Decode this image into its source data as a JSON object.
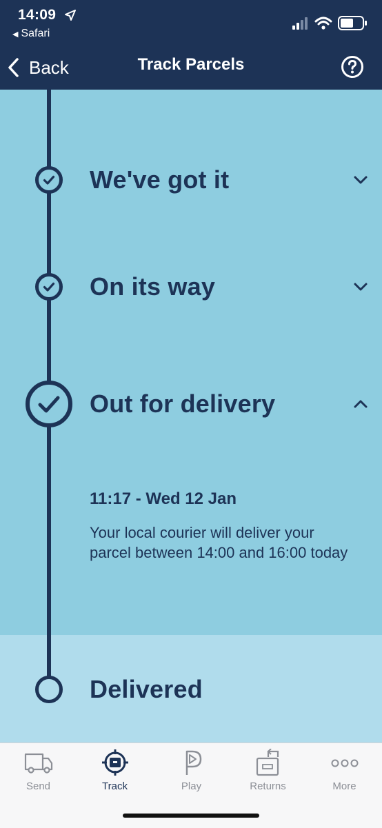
{
  "status_bar": {
    "time": "14:09",
    "back_app": "Safari"
  },
  "nav": {
    "back_label": "Back",
    "title": "Track Parcels"
  },
  "stages": [
    {
      "title": "We've got it",
      "state": "complete",
      "expanded": false
    },
    {
      "title": "On its way",
      "state": "complete",
      "expanded": false
    },
    {
      "title": "Out for delivery",
      "state": "current",
      "expanded": true
    },
    {
      "title": "Delivered",
      "state": "pending",
      "expanded": false
    }
  ],
  "event": {
    "time": "11:17 - Wed 12 Jan",
    "text": "Your local courier will deliver your parcel between 14:00 and 16:00 today"
  },
  "tabs": [
    {
      "label": "Send",
      "icon": "van-icon",
      "active": false
    },
    {
      "label": "Track",
      "icon": "track-target-icon",
      "active": true
    },
    {
      "label": "Play",
      "icon": "play-p-icon",
      "active": false
    },
    {
      "label": "Returns",
      "icon": "returns-box-icon",
      "active": false
    },
    {
      "label": "More",
      "icon": "more-dots-icon",
      "active": false
    }
  ],
  "colors": {
    "brand_navy": "#1d3356",
    "complete_bg": "#8ecde0",
    "pending_bg": "#b0dcec",
    "tabbar_bg": "#f7f7f8",
    "tab_inactive": "#8c8f96"
  }
}
